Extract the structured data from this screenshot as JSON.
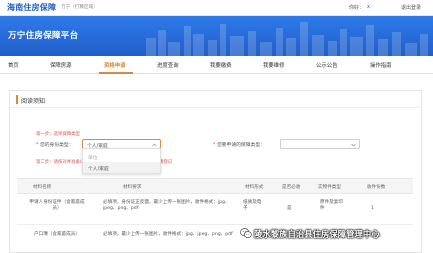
{
  "header": {
    "brand": "海南住房保障",
    "region": "万宁（打算区域）",
    "greeting": "你好：",
    "username": "x",
    "logout": "退出登录"
  },
  "banner": {
    "title": "万宁住房保障平台"
  },
  "nav": {
    "items": [
      "首页",
      "保障房源",
      "资格申请",
      "进度查询",
      "我要缴费",
      "我要维修",
      "公示公告",
      "操作指南"
    ],
    "active_index": 2
  },
  "panel": {
    "title": "阅读须知",
    "step1": "第一步：选择保障类型",
    "identity_label": "您的身份类型：",
    "identity_value": "个人/家庭",
    "housing_label": "您要申请的保障类型：",
    "housing_value": "",
    "step2": "第二步：请核对并准备以下材料，确认后点击下一步进行资格申请登记",
    "dropdown": {
      "placeholder": "单位",
      "options": [
        "个人/家庭"
      ]
    }
  },
  "table": {
    "headers": [
      "材料名称",
      "材料要求",
      "材料形式",
      "是否必收",
      "实物件类型",
      "收件份数"
    ],
    "rows": [
      {
        "name": "申请人身份证件（含家庭成员）",
        "requirement": "必填项，身份证正反面，最少上传一张图片，收件格式：jpg、jpeg、png、pdf",
        "form": "纸质及电子",
        "required": "是",
        "type": "原件及复印件",
        "copies": "1"
      },
      {
        "name": "户口簿（含家庭成员）",
        "requirement": "必填项，最少上传一张图片，收件格式：jpg、jpeg、png、pdf",
        "form": "",
        "required": "",
        "type": "",
        "copies": ""
      }
    ]
  },
  "watermark": {
    "text": "陵水黎族自治县住房保障管理中心"
  },
  "colors": {
    "brand": "#1f5fc7",
    "banner": "#2a6fdc",
    "accent": "#d98a3d",
    "step": "#e0554f"
  }
}
